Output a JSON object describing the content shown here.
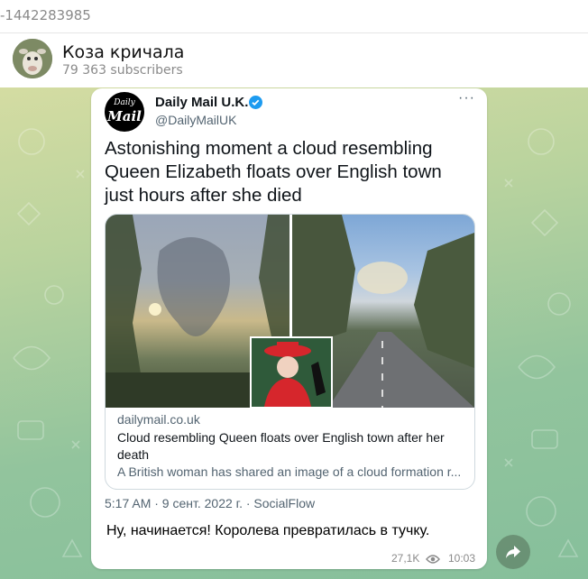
{
  "window": {
    "chat_id": "-1442283985"
  },
  "channel": {
    "name": "Коза кричала",
    "subscribers": "79 363 subscribers"
  },
  "tweet": {
    "logo_line1": "Daily",
    "logo_line2": "Mail",
    "author_name": "Daily Mail U.K.",
    "handle": "@DailyMailUK",
    "more": "···",
    "headline": "Astonishing moment a cloud resembling Queen Elizabeth floats over English town just hours after she died",
    "card": {
      "domain": "dailymail.co.uk",
      "title": "Cloud resembling Queen floats over English town after her death",
      "description": "A British woman has shared an image of a cloud formation r..."
    },
    "meta": "5:17 AM · 9 сент. 2022 г. · SocialFlow"
  },
  "message": {
    "caption": "Ну, начинается! Королева превратилась в тучку.",
    "views": "27,1K",
    "time": "10:03"
  },
  "colors": {
    "verified": "#1d9bf0",
    "chat_bg_top": "#d4dca2",
    "chat_bg_bottom": "#86bf9b"
  }
}
